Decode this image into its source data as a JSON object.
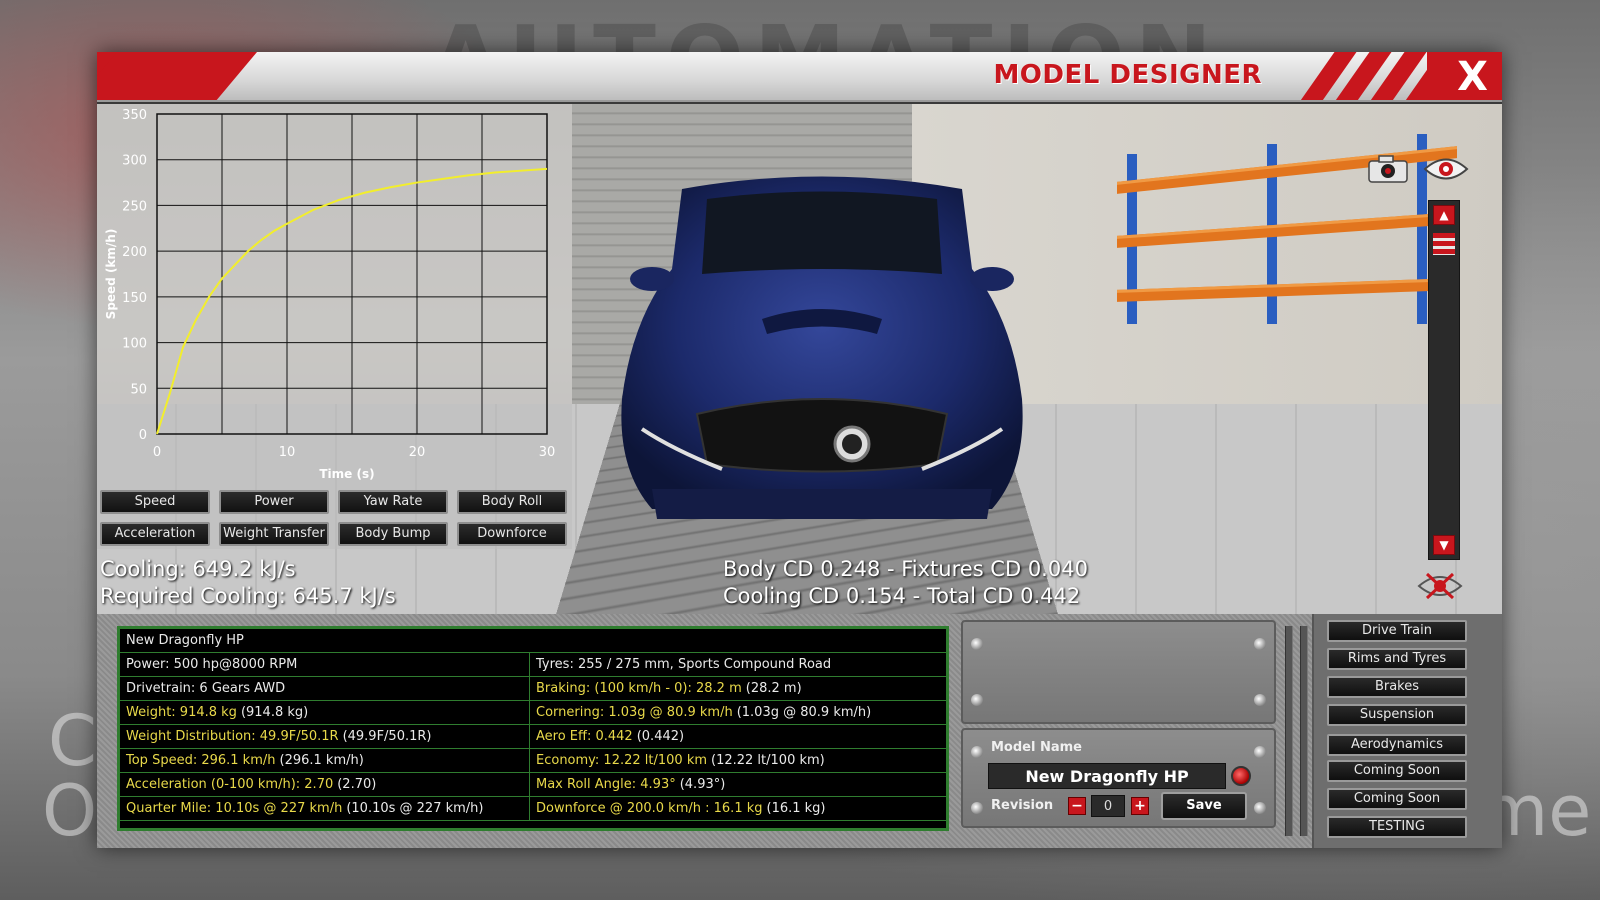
{
  "window": {
    "title": "MODEL DESIGNER",
    "close_label": "X"
  },
  "chart_data": {
    "type": "line",
    "title": "",
    "xlabel": "Time (s)",
    "ylabel": "Speed (km/h)",
    "xlim": [
      0,
      30
    ],
    "ylim": [
      0,
      350
    ],
    "x_ticks": [
      0,
      10,
      20,
      30
    ],
    "y_ticks": [
      0,
      50,
      100,
      150,
      200,
      250,
      300,
      350
    ],
    "grid": true,
    "series": [
      {
        "name": "",
        "color": "#f2ee2c",
        "x": [
          0,
          1,
          2,
          3,
          4,
          5,
          6,
          7,
          8,
          9,
          10,
          12,
          14,
          16,
          18,
          20,
          22,
          24,
          26,
          28,
          30
        ],
        "y": [
          0,
          45,
          95,
          125,
          150,
          170,
          185,
          200,
          212,
          222,
          230,
          245,
          256,
          264,
          270,
          275,
          279,
          283,
          286,
          288,
          290
        ]
      }
    ]
  },
  "graph_buttons": [
    "Speed",
    "Power",
    "Yaw Rate",
    "Body Roll",
    "Acceleration",
    "Weight Transfer",
    "Body Bump",
    "Downforce"
  ],
  "cooling": {
    "line1": "Cooling: 649.2 kJ/s",
    "line2": "Required Cooling: 645.7 kJ/s"
  },
  "aero": {
    "line1": "Body CD 0.248 - Fixtures CD 0.040",
    "line2": "Cooling CD 0.154 - Total CD 0.442"
  },
  "info": {
    "title": "New Dragonfly HP",
    "rows": [
      {
        "left": "Power: 500 hp@8000 RPM",
        "left_color": "w",
        "right": "Tyres: 255 / 275 mm, Sports Compound Road",
        "right_color": "w"
      },
      {
        "left": "Drivetrain: 6 Gears AWD",
        "left_color": "w",
        "right": "Braking: (100 km/h - 0): 28.2 m",
        "right_extra": "(28.2 m)",
        "right_color": "y"
      },
      {
        "left": "Weight: 914.8 kg",
        "left_extra": "(914.8 kg)",
        "left_color": "y",
        "right": "Cornering: 1.03g @ 80.9 km/h",
        "right_extra": "(1.03g @ 80.9 km/h)",
        "right_color": "y"
      },
      {
        "left": "Weight Distribution: 49.9F/50.1R",
        "left_extra": "(49.9F/50.1R)",
        "left_color": "y",
        "right": "Aero Eff: 0.442",
        "right_extra": "(0.442)",
        "right_color": "y"
      },
      {
        "left": "Top Speed: 296.1 km/h",
        "left_extra": "(296.1 km/h)",
        "left_color": "y",
        "right": "Economy: 12.22 lt/100 km",
        "right_extra": "(12.22 lt/100 km)",
        "right_color": "y"
      },
      {
        "left": "Acceleration (0-100 km/h): 2.70",
        "left_extra": "(2.70)",
        "left_color": "y",
        "right": "Max Roll Angle: 4.93°",
        "right_extra": "(4.93°)",
        "right_color": "y"
      },
      {
        "left": "Quarter Mile: 10.10s @ 227 km/h",
        "left_extra": "(10.10s @ 227 km/h)",
        "left_color": "y",
        "right": "Downforce @ 200.0 km/h : 16.1 kg",
        "right_extra": "(16.1 kg)",
        "right_color": "y"
      }
    ]
  },
  "model": {
    "name_label": "Model Name",
    "name_value": "New Dragonfly HP",
    "revision_label": "Revision",
    "revision_value": "0",
    "minus": "−",
    "plus": "+",
    "save_label": "Save"
  },
  "side_menu": [
    "Drive Train",
    "Rims and Tyres",
    "Brakes",
    "Suspension",
    "Aerodynamics",
    "Coming Soon",
    "Coming Soon",
    "TESTING"
  ],
  "background": {
    "logo_text": "AUTOMATION",
    "left_letters": [
      "C",
      "O"
    ],
    "right_letters": "me"
  },
  "colors": {
    "accent_red": "#c8161d",
    "table_green": "#2f7d2f",
    "highlight_yellow": "#e8d94a",
    "car_blue": "#1c2a6b"
  }
}
